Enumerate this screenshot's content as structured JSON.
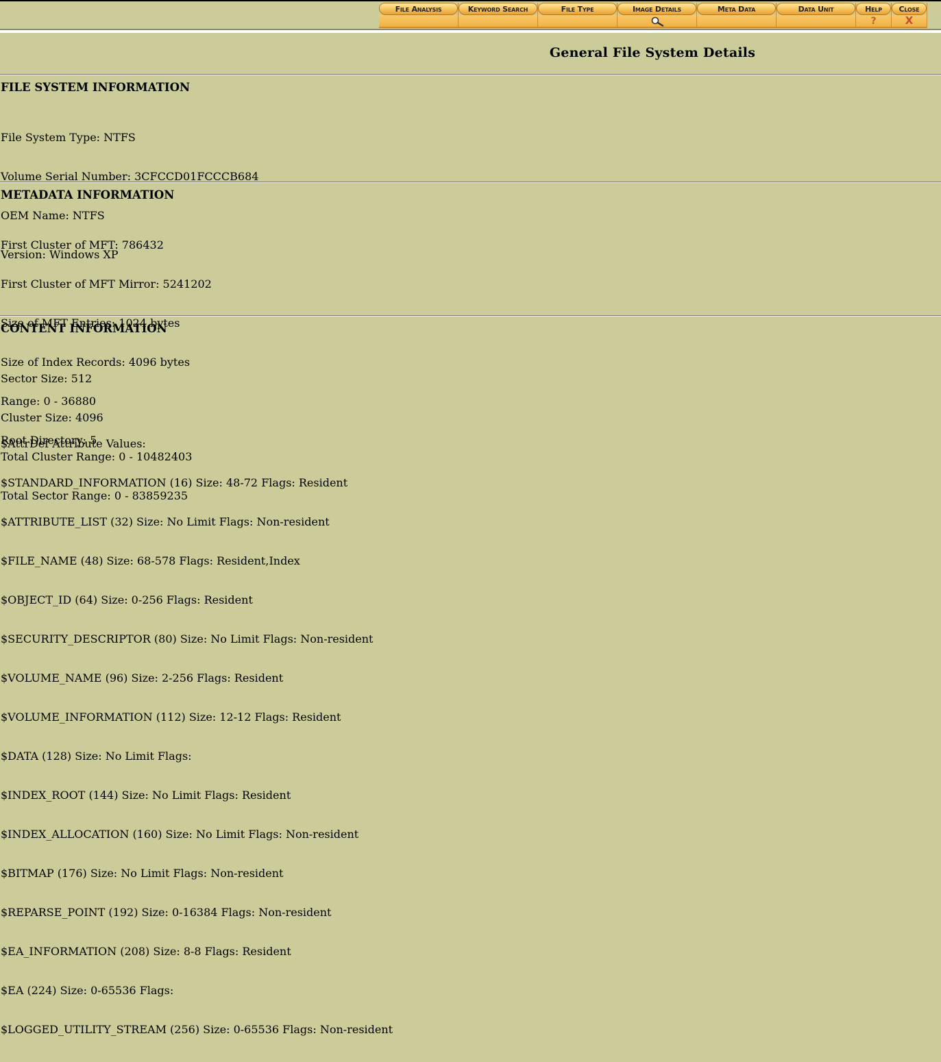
{
  "toolbar": {
    "tabs": [
      {
        "label": "File Analysis",
        "glyph": ""
      },
      {
        "label": "Keyword Search",
        "glyph": ""
      },
      {
        "label": "File Type",
        "glyph": ""
      },
      {
        "label": "Image Details",
        "glyph": "magnifier-icon"
      },
      {
        "label": "Meta Data",
        "glyph": ""
      },
      {
        "label": "Data Unit",
        "glyph": ""
      },
      {
        "label": "Help",
        "glyph": "?"
      },
      {
        "label": "Close",
        "glyph": "X"
      }
    ]
  },
  "page": {
    "title": "General File System Details"
  },
  "fs_info": {
    "heading": "FILE SYSTEM INFORMATION",
    "lines": [
      "File System Type: NTFS",
      "Volume Serial Number: 3CFCCD01FCCCB684",
      "OEM Name: NTFS",
      "Version: Windows XP"
    ]
  },
  "meta_info": {
    "heading": "METADATA INFORMATION",
    "lines": [
      "First Cluster of MFT: 786432",
      "First Cluster of MFT Mirror: 5241202",
      "Size of MFT Entries: 1024 bytes",
      "Size of Index Records: 4096 bytes",
      "Range: 0 - 36880",
      "Root Directory: 5"
    ]
  },
  "content_info": {
    "heading": "CONTENT INFORMATION",
    "lines": [
      "Sector Size: 512",
      "Cluster Size: 4096",
      "Total Cluster Range: 0 - 10482403",
      "Total Sector Range: 0 - 83859235"
    ],
    "attrdef_heading": "$AttrDef Attribute Values:",
    "attrdef": [
      "$STANDARD_INFORMATION (16) Size: 48-72 Flags: Resident",
      "$ATTRIBUTE_LIST (32) Size: No Limit Flags: Non-resident",
      "$FILE_NAME (48) Size: 68-578 Flags: Resident,Index",
      "$OBJECT_ID (64) Size: 0-256 Flags: Resident",
      "$SECURITY_DESCRIPTOR (80) Size: No Limit Flags: Non-resident",
      "$VOLUME_NAME (96) Size: 2-256 Flags: Resident",
      "$VOLUME_INFORMATION (112) Size: 12-12 Flags: Resident",
      "$DATA (128) Size: No Limit Flags:",
      "$INDEX_ROOT (144) Size: No Limit Flags: Resident",
      "$INDEX_ALLOCATION (160) Size: No Limit Flags: Non-resident",
      "$BITMAP (176) Size: No Limit Flags: Non-resident",
      "$REPARSE_POINT (192) Size: 0-16384 Flags: Non-resident",
      "$EA_INFORMATION (208) Size: 8-8 Flags: Resident",
      "$EA (224) Size: 0-65536 Flags:",
      "$LOGGED_UTILITY_STREAM (256) Size: 0-65536 Flags: Non-resident"
    ]
  }
}
